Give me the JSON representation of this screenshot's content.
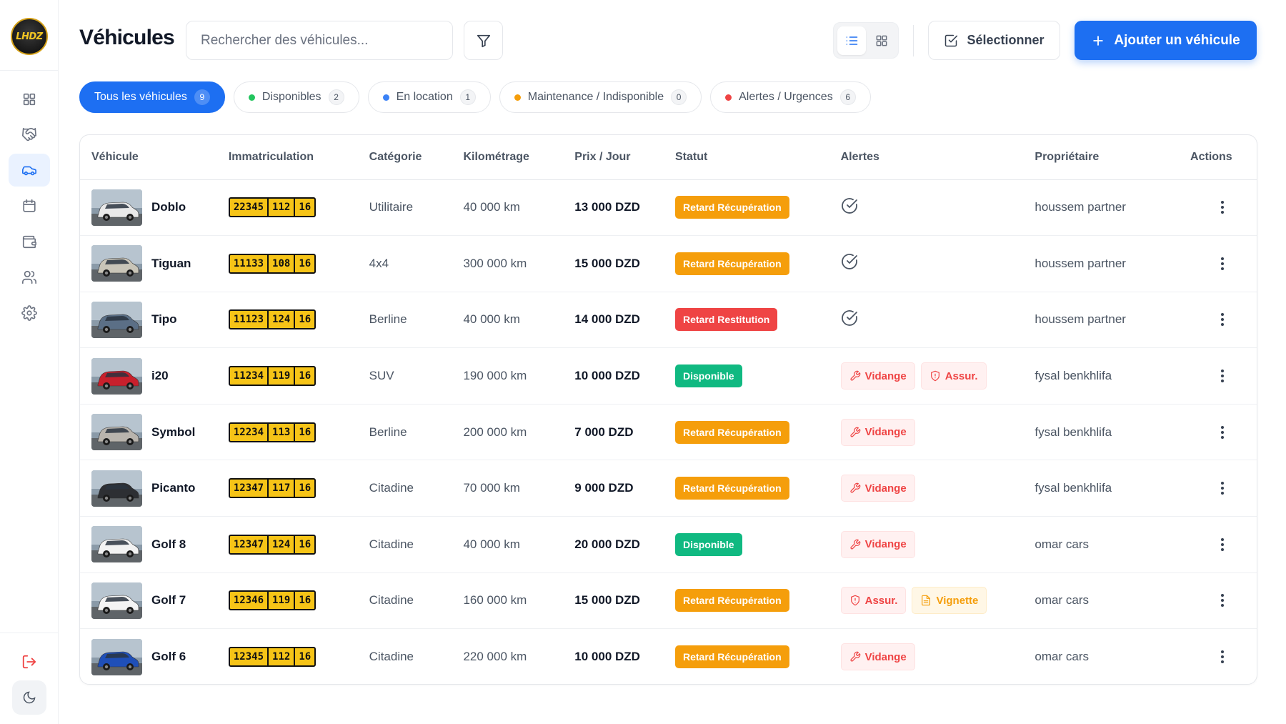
{
  "app": {
    "logo_text": "LHDZ"
  },
  "header": {
    "title": "Véhicules",
    "search_placeholder": "Rechercher des véhicules...",
    "select_label": "Sélectionner",
    "add_label": "Ajouter un véhicule"
  },
  "sidebar": {
    "items": [
      {
        "name": "dashboard",
        "icon": "grid-icon",
        "active": false
      },
      {
        "name": "rentals",
        "icon": "handshake-icon",
        "active": false
      },
      {
        "name": "vehicles",
        "icon": "car-icon",
        "active": true
      },
      {
        "name": "calendar",
        "icon": "calendar-icon",
        "active": false
      },
      {
        "name": "wallet",
        "icon": "wallet-icon",
        "active": false
      },
      {
        "name": "clients",
        "icon": "users-icon",
        "active": false
      },
      {
        "name": "settings",
        "icon": "gear-icon",
        "active": false
      }
    ]
  },
  "filters": [
    {
      "label": "Tous les véhicules",
      "count": "9",
      "active": true,
      "dot": ""
    },
    {
      "label": "Disponibles",
      "count": "2",
      "active": false,
      "dot": "#22c55e"
    },
    {
      "label": "En location",
      "count": "1",
      "active": false,
      "dot": "#3b82f6"
    },
    {
      "label": "Maintenance / Indisponible",
      "count": "0",
      "active": false,
      "dot": "#f59e0b"
    },
    {
      "label": "Alertes / Urgences",
      "count": "6",
      "active": false,
      "dot": "#ef4444"
    }
  ],
  "table": {
    "columns": [
      "Véhicule",
      "Immatriculation",
      "Catégorie",
      "Kilométrage",
      "Prix / Jour",
      "Statut",
      "Alertes",
      "Propriétaire",
      "Actions"
    ],
    "rows": [
      {
        "name": "Doblo",
        "plate": [
          "22345",
          "112",
          "16"
        ],
        "category": "Utilitaire",
        "km": "40 000 km",
        "price": "13 000 DZD",
        "status": "Retard Récupération",
        "status_color": "#f59e0b",
        "alerts": [],
        "owner": "houssem partner",
        "car_color": "#e9e9e9"
      },
      {
        "name": "Tiguan",
        "plate": [
          "11133",
          "108",
          "16"
        ],
        "category": "4x4",
        "km": "300 000 km",
        "price": "15 000 DZD",
        "status": "Retard Récupération",
        "status_color": "#f59e0b",
        "alerts": [],
        "owner": "houssem partner",
        "car_color": "#c9c5b8"
      },
      {
        "name": "Tipo",
        "plate": [
          "11123",
          "124",
          "16"
        ],
        "category": "Berline",
        "km": "40 000 km",
        "price": "14 000 DZD",
        "status": "Retard Restitution",
        "status_color": "#ef4444",
        "alerts": [],
        "owner": "houssem partner",
        "car_color": "#5b6f86"
      },
      {
        "name": "i20",
        "plate": [
          "11234",
          "119",
          "16"
        ],
        "category": "SUV",
        "km": "190 000 km",
        "price": "10 000 DZD",
        "status": "Disponible",
        "status_color": "#10b981",
        "alerts": [
          {
            "label": "Vidange",
            "type": "red",
            "icon": "wrench-icon"
          },
          {
            "label": "Assur.",
            "type": "red",
            "icon": "shield-icon"
          }
        ],
        "owner": "fysal benkhlifa",
        "car_color": "#c8202c"
      },
      {
        "name": "Symbol",
        "plate": [
          "12234",
          "113",
          "16"
        ],
        "category": "Berline",
        "km": "200 000 km",
        "price": "7 000 DZD",
        "status": "Retard Récupération",
        "status_color": "#f59e0b",
        "alerts": [
          {
            "label": "Vidange",
            "type": "red",
            "icon": "wrench-icon"
          }
        ],
        "owner": "fysal benkhlifa",
        "car_color": "#b9b4ad"
      },
      {
        "name": "Picanto",
        "plate": [
          "12347",
          "117",
          "16"
        ],
        "category": "Citadine",
        "km": "70 000 km",
        "price": "9 000 DZD",
        "status": "Retard Récupération",
        "status_color": "#f59e0b",
        "alerts": [
          {
            "label": "Vidange",
            "type": "red",
            "icon": "wrench-icon"
          }
        ],
        "owner": "fysal benkhlifa",
        "car_color": "#2d2f33"
      },
      {
        "name": "Golf 8",
        "plate": [
          "12347",
          "124",
          "16"
        ],
        "category": "Citadine",
        "km": "40 000 km",
        "price": "20 000 DZD",
        "status": "Disponible",
        "status_color": "#10b981",
        "alerts": [
          {
            "label": "Vidange",
            "type": "red",
            "icon": "wrench-icon"
          }
        ],
        "owner": "omar cars",
        "car_color": "#f2f2f2"
      },
      {
        "name": "Golf 7",
        "plate": [
          "12346",
          "119",
          "16"
        ],
        "category": "Citadine",
        "km": "160 000 km",
        "price": "15 000 DZD",
        "status": "Retard Récupération",
        "status_color": "#f59e0b",
        "alerts": [
          {
            "label": "Assur.",
            "type": "red",
            "icon": "shield-icon"
          },
          {
            "label": "Vignette",
            "type": "amber",
            "icon": "document-icon"
          }
        ],
        "owner": "omar cars",
        "car_color": "#f4f4f4"
      },
      {
        "name": "Golf 6",
        "plate": [
          "12345",
          "112",
          "16"
        ],
        "category": "Citadine",
        "km": "220 000 km",
        "price": "10 000 DZD",
        "status": "Retard Récupération",
        "status_color": "#f59e0b",
        "alerts": [
          {
            "label": "Vidange",
            "type": "red",
            "icon": "wrench-icon"
          }
        ],
        "owner": "omar cars",
        "car_color": "#1f4fb8"
      }
    ]
  }
}
